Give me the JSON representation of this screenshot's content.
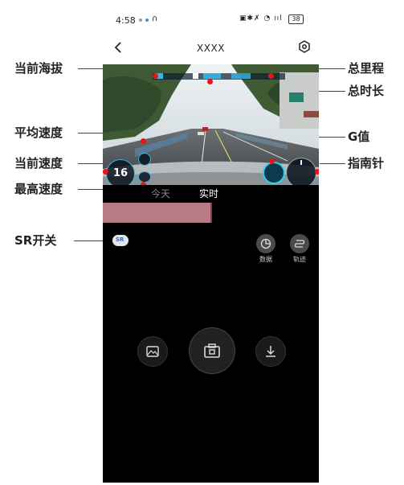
{
  "status_bar": {
    "time": "4:58",
    "battery": "38"
  },
  "nav": {
    "title": "XXXX"
  },
  "video": {
    "speed_value": "16"
  },
  "tabs": {
    "today": "今天",
    "realtime": "实时"
  },
  "side_buttons": {
    "data_label": "数据",
    "track_label": "轨迹"
  },
  "sr_toggle": {
    "label": "SR"
  },
  "annotations": {
    "left": [
      "当前海拔",
      "平均速度",
      "当前速度",
      "最高速度",
      "SR开关"
    ],
    "right": [
      "总里程",
      "总时长",
      "G值",
      "指南针"
    ]
  },
  "colors": {
    "marker": "#e8141b",
    "pink_band": "#b87a84"
  }
}
